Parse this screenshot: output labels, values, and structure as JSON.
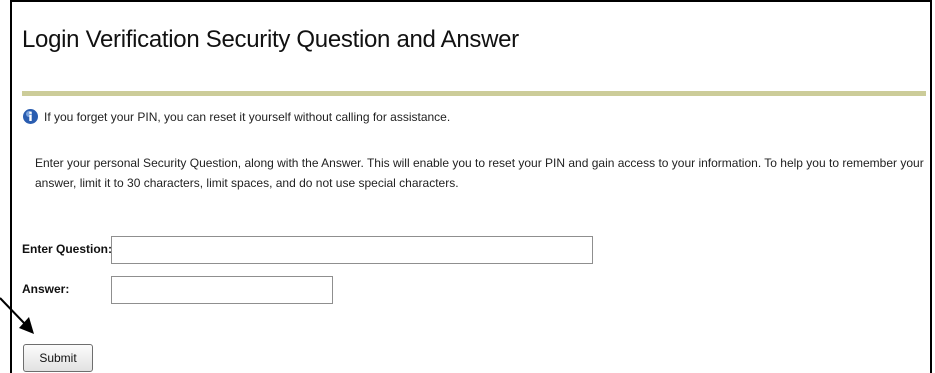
{
  "page": {
    "title": "Login Verification Security Question and Answer"
  },
  "info": {
    "icon": "info-icon",
    "text": "If you forget your PIN, you can reset it yourself without calling for assistance."
  },
  "instructions": {
    "text": "Enter your personal Security Question, along with the Answer. This will enable you to reset your PIN and gain access to your information. To help you to remember your answer, limit it to 30 characters, limit spaces, and do not use special characters."
  },
  "form": {
    "question_label": "Enter Question:",
    "question_value": "",
    "answer_label": "Answer:",
    "answer_value": "",
    "submit_label": "Submit"
  },
  "colors": {
    "title_rule": "#cccc99",
    "info_icon": "#2a5db0"
  }
}
